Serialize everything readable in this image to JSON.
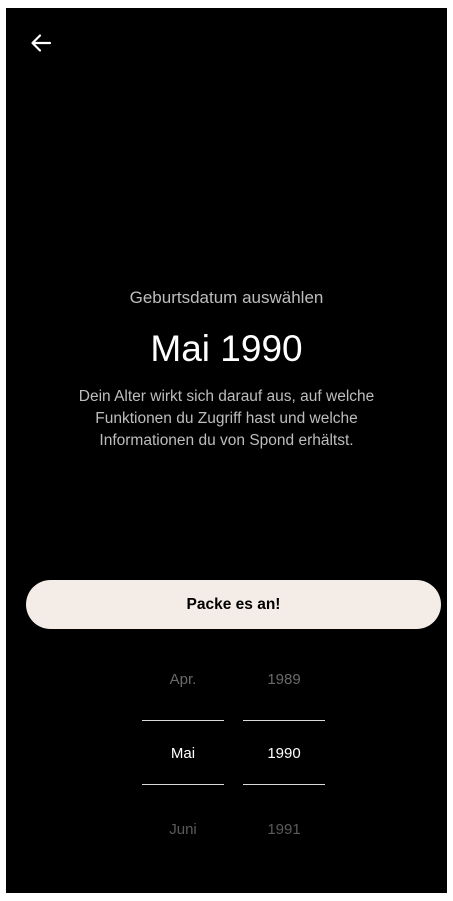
{
  "header": {
    "back_icon": "arrow-left-icon"
  },
  "main": {
    "subtitle": "Geburtsdatum auswählen",
    "title": "Mai 1990",
    "description": "Dein Alter wirkt sich darauf aus, auf welche Funktionen du Zugriff hast und welche Informationen du von Spond erhältst.",
    "cta_label": "Packe es an!"
  },
  "picker": {
    "month": {
      "prev": "Apr.",
      "selected": "Mai",
      "next": "Juni"
    },
    "year": {
      "prev": "1989",
      "selected": "1990",
      "next": "1991"
    }
  },
  "colors": {
    "background": "#000000",
    "button_bg": "#f4ece6",
    "text_primary": "#ffffff",
    "text_secondary": "#bdbdbd"
  }
}
